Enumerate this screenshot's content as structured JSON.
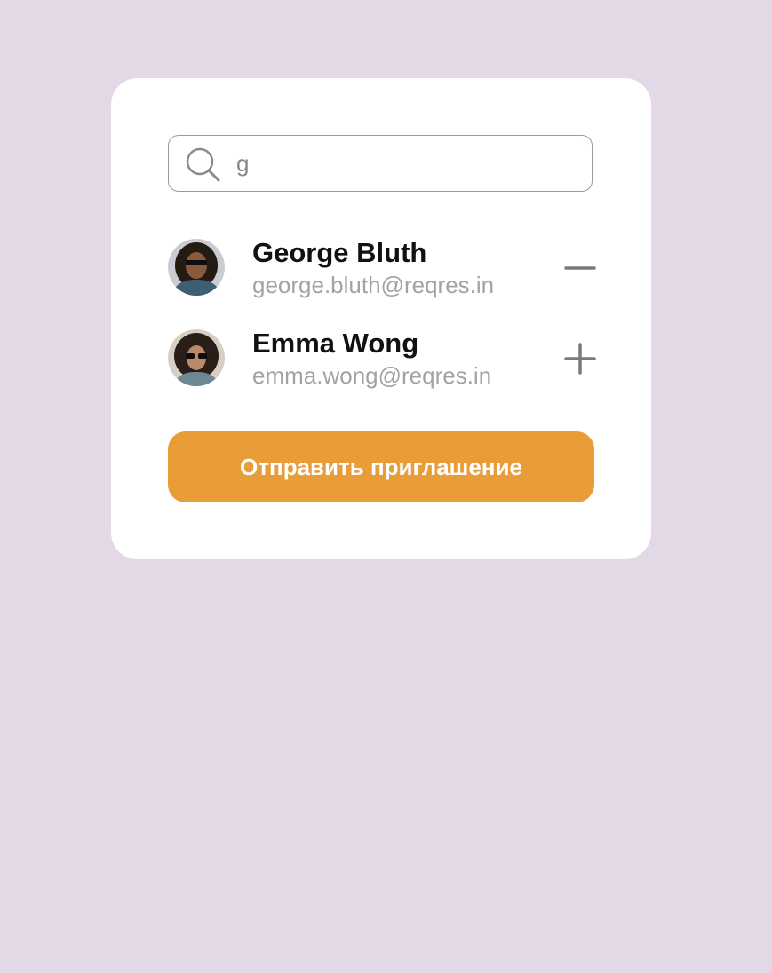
{
  "search": {
    "value": "g",
    "icon": "search-icon"
  },
  "users": [
    {
      "name": "George Bluth",
      "email": "george.bluth@reqres.in",
      "action_icon": "minus-icon"
    },
    {
      "name": "Emma Wong",
      "email": "emma.wong@reqres.in",
      "action_icon": "plus-icon"
    }
  ],
  "send_button": {
    "label": "Отправить приглашение"
  },
  "colors": {
    "background": "#e3d8e6",
    "card": "#ffffff",
    "accent": "#e89d38",
    "name_text": "#111111",
    "email_text": "#a3a3a3"
  }
}
